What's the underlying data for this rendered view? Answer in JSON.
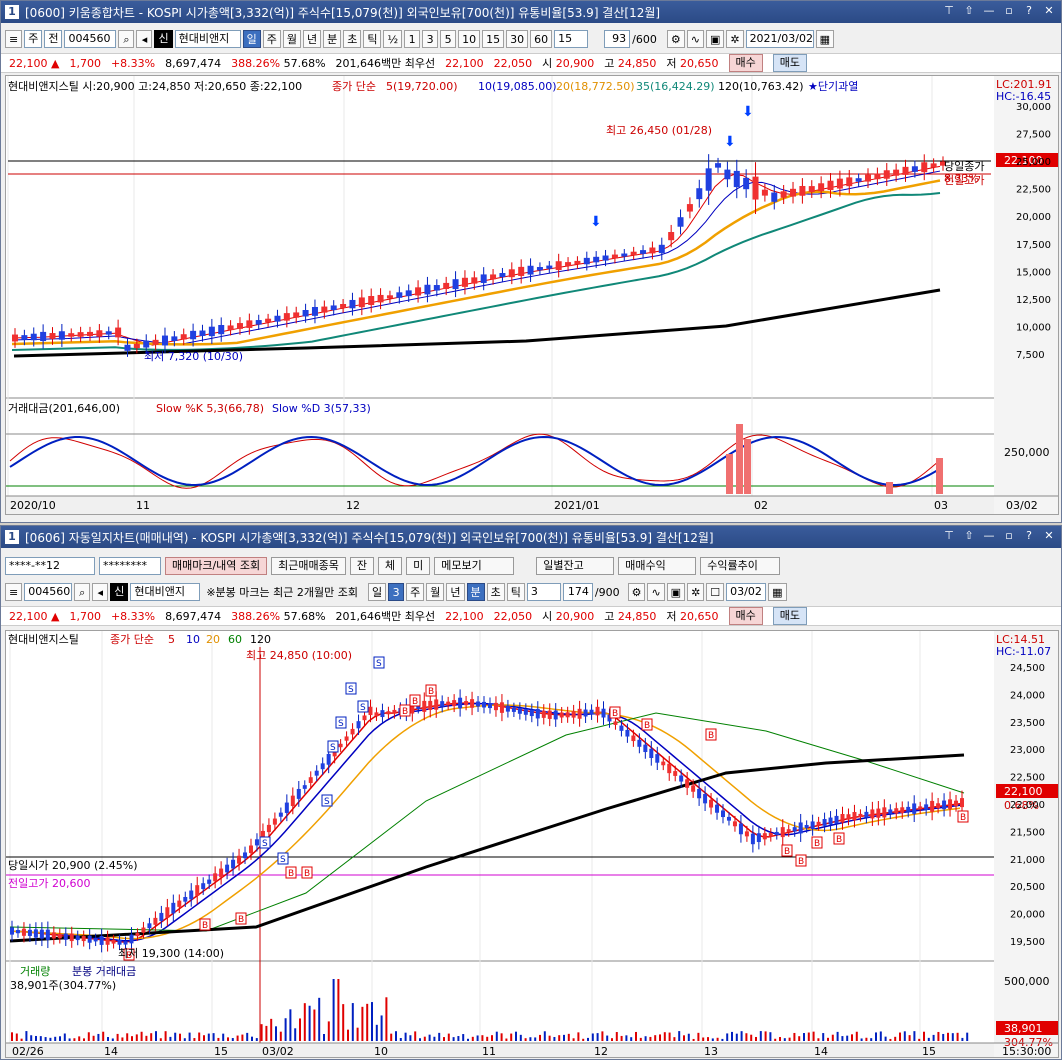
{
  "top": {
    "window_num": "1",
    "title": "[0600] 키움종합차트 - KOSPI 시가총액[3,332(억)] 주식수[15,079(천)] 외국인보유[700(천)] 유통비율[53.9] 결산[12월]",
    "toolbar": {
      "type1": "주",
      "type2": "전",
      "code": "004560",
      "tag": "신",
      "name": "현대비앤지",
      "periods": [
        "일",
        "주",
        "월",
        "년",
        "분",
        "초",
        "틱"
      ],
      "nums": [
        "1",
        "3",
        "5",
        "10",
        "15",
        "30",
        "60"
      ],
      "interval": "15",
      "count": "93",
      "count_max": "/600",
      "date": "2021/03/02"
    },
    "quote": {
      "price": "22,100",
      "arrow": "▲",
      "change": "1,700",
      "rate": "+8.33%",
      "volume": "8,697,474",
      "vol_ratio": "388.26%",
      "turnover": "57.68%",
      "amount": "201,646백만",
      "pref_label": "최우선",
      "bid": "22,100",
      "ask": "22,050",
      "open_label": "시",
      "open": "20,900",
      "high_label": "고",
      "high": "24,850",
      "low_label": "저",
      "low": "20,650",
      "buy": "매수",
      "sell": "매도"
    },
    "legend": {
      "name": "현대비앤지스틸 시:20,900 고:24,850 저:20,650 종:22,100",
      "ma_label": "종가 단순",
      "ma5": "5(19,720.00)",
      "ma10": "10(19,085.00)",
      "ma20": "20(18,772.50)",
      "ma35": "35(16,424.29)",
      "ma120": "120(10,763.42)",
      "signal": "★단기과열"
    },
    "lc": "LC:201.91",
    "hc": "HC:-16.45",
    "high_note": "최고 26,450 (01/28)",
    "low_note": "최저 7,320 (10/30)",
    "right_notes": [
      "당일종가",
      "8.33%",
      "전일고가"
    ],
    "price_tag": "22,100",
    "y_ticks": [
      "30,000",
      "27,500",
      "25,000",
      "22,500",
      "20,000",
      "17,500",
      "15,000",
      "12,500",
      "10,000",
      "7,500"
    ],
    "sub_legend": [
      "거래대금(201,646,00)",
      "Slow %K 5,3(66,78)",
      "Slow %D 3(57,33)"
    ],
    "sub_tick": "250,000",
    "x_labels": [
      "2020/10",
      "11",
      "12",
      "2021/01",
      "02",
      "03"
    ],
    "x_right": "03/02"
  },
  "bottom": {
    "window_num": "1",
    "title": "[0606] 자동일지차트(매매내역) - KOSPI 시가총액[3,332(억)] 주식수[15,079(천)] 외국인보유[700(천)] 유통비율[53.9] 결산[12월]",
    "account": "****-**12",
    "password": "********",
    "buttons": [
      "매매마크/내역 조회",
      "최근매매종목",
      "잔",
      "체",
      "미",
      "메모보기"
    ],
    "buttons2": [
      "일별잔고",
      "매매수익",
      "수익률추이"
    ],
    "toolbar": {
      "code": "004560",
      "tag": "신",
      "name": "현대비앤지",
      "note": "※분봉 마크는 최근 2개월만 조회",
      "periods": [
        "일",
        "3",
        "주",
        "월",
        "년",
        "분",
        "초",
        "틱"
      ],
      "interval": "3",
      "count": "174",
      "count_max": "/900",
      "date": "03/02"
    },
    "quote": {
      "price": "22,100",
      "arrow": "▲",
      "change": "1,700",
      "rate": "+8.33%",
      "volume": "8,697,474",
      "vol_ratio": "388.26%",
      "turnover": "57.68%",
      "amount": "201,646백만",
      "pref_label": "최우선",
      "bid": "22,100",
      "ask": "22,050",
      "open_label": "시",
      "open": "20,900",
      "high_label": "고",
      "high": "24,850",
      "low_label": "저",
      "low": "20,650",
      "buy": "매수",
      "sell": "매도"
    },
    "legend": {
      "name": "현대비앤지스틸",
      "ma_label": "종가 단순",
      "ma5": "5",
      "ma10": "10",
      "ma20": "20",
      "ma60": "60",
      "ma120": "120"
    },
    "lc": "LC:14.51",
    "hc": "HC:-11.07",
    "high_note": "최고 24,850 (10:00)",
    "low_note": "최저 19,300 (14:00)",
    "open_note": "당일시가 20,900 (2.45%)",
    "prev_high_note": "전일고가 20,600",
    "price_tag": "22,100",
    "rate_tag": "0.68%",
    "y_ticks": [
      "24,500",
      "24,000",
      "23,500",
      "23,000",
      "22,500",
      "22,000",
      "21,500",
      "21,000",
      "20,500",
      "20,000",
      "19,500"
    ],
    "vol_legend": [
      "거래량",
      "분봉 거래대금"
    ],
    "vol_value": "38,901주(304.77%)",
    "vol_tick": "500,000",
    "vol_tag1": "38,901",
    "vol_tag2": "304.77%",
    "x_labels": [
      "02/26",
      "14",
      "15",
      "03/02",
      "10",
      "11",
      "12",
      "13",
      "14",
      "15"
    ],
    "x_right": "15:30:00"
  },
  "colors": {
    "up": "#e00000",
    "down": "#0020c0",
    "ma5": "#e00000",
    "ma10": "#0000c0",
    "ma20": "#f0a000",
    "ma35": "#108878",
    "ma60": "#008000",
    "ma120": "#000000"
  }
}
